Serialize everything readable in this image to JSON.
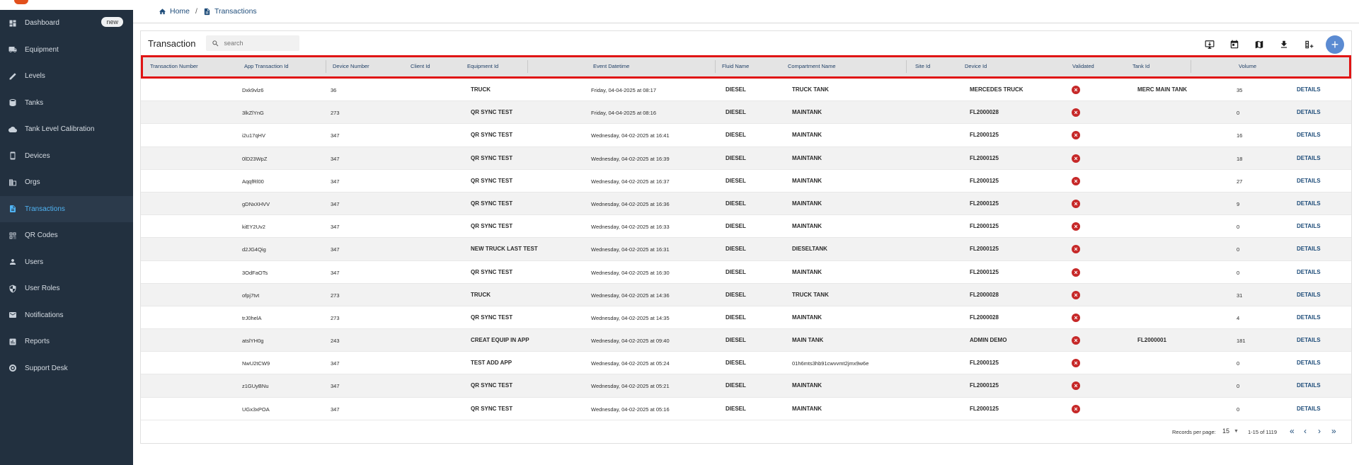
{
  "sidebar": {
    "items": [
      {
        "label": "Dashboard",
        "icon": "dashboard-icon",
        "badge": "new"
      },
      {
        "label": "Equipment",
        "icon": "truck-icon"
      },
      {
        "label": "Levels",
        "icon": "ruler-icon"
      },
      {
        "label": "Tanks",
        "icon": "database-icon"
      },
      {
        "label": "Tank Level Calibration",
        "icon": "cloud-icon"
      },
      {
        "label": "Devices",
        "icon": "device-icon"
      },
      {
        "label": "Orgs",
        "icon": "building-icon"
      },
      {
        "label": "Transactions",
        "icon": "receipt-icon",
        "active": true
      },
      {
        "label": "QR Codes",
        "icon": "qr-icon"
      },
      {
        "label": "Users",
        "icon": "user-icon"
      },
      {
        "label": "User Roles",
        "icon": "shield-icon"
      },
      {
        "label": "Notifications",
        "icon": "bell-icon"
      },
      {
        "label": "Reports",
        "icon": "chart-icon"
      },
      {
        "label": "Support Desk",
        "icon": "support-icon"
      }
    ]
  },
  "breadcrumb": {
    "home": "Home",
    "separator": "/",
    "current": "Transactions"
  },
  "panel": {
    "title": "Transaction",
    "search_placeholder": "search"
  },
  "table": {
    "columns": [
      "Transaction Number",
      "App Transaction Id",
      "Device Number",
      "Client Id",
      "Equipment Id",
      "Event Datetime",
      "Fluid Name",
      "Compartment Name",
      "Site Id",
      "Device Id",
      "Validated",
      "Tank Id",
      "Volume"
    ],
    "rows": [
      {
        "app_id": "Dxk9vlz6",
        "device_number": "36",
        "equipment": "TRUCK",
        "datetime": "Friday, 04-04-2025 at 08:17",
        "fluid": "DIESEL",
        "compartment": "TRUCK TANK",
        "device_id": "MERCEDES TRUCK",
        "tank_id": "MERC MAIN TANK",
        "volume": "35"
      },
      {
        "app_id": "3lkZlYnG",
        "device_number": "273",
        "equipment": "QR SYNC TEST",
        "datetime": "Friday, 04-04-2025 at 08:16",
        "fluid": "DIESEL",
        "compartment": "MAINTANK",
        "device_id": "FL2000028",
        "tank_id": "",
        "volume": "0"
      },
      {
        "app_id": "i2u17qHV",
        "device_number": "347",
        "equipment": "QR SYNC TEST",
        "datetime": "Wednesday, 04-02-2025 at 16:41",
        "fluid": "DIESEL",
        "compartment": "MAINTANK",
        "device_id": "FL2000125",
        "tank_id": "",
        "volume": "16"
      },
      {
        "app_id": "0lD23WpZ",
        "device_number": "347",
        "equipment": "QR SYNC TEST",
        "datetime": "Wednesday, 04-02-2025 at 16:39",
        "fluid": "DIESEL",
        "compartment": "MAINTANK",
        "device_id": "FL2000125",
        "tank_id": "",
        "volume": "18"
      },
      {
        "app_id": "AqqfRl00",
        "device_number": "347",
        "equipment": "QR SYNC TEST",
        "datetime": "Wednesday, 04-02-2025 at 16:37",
        "fluid": "DIESEL",
        "compartment": "MAINTANK",
        "device_id": "FL2000125",
        "tank_id": "",
        "volume": "27"
      },
      {
        "app_id": "gDNxXHVV",
        "device_number": "347",
        "equipment": "QR SYNC TEST",
        "datetime": "Wednesday, 04-02-2025 at 16:36",
        "fluid": "DIESEL",
        "compartment": "MAINTANK",
        "device_id": "FL2000125",
        "tank_id": "",
        "volume": "9"
      },
      {
        "app_id": "kiEY2Uv2",
        "device_number": "347",
        "equipment": "QR SYNC TEST",
        "datetime": "Wednesday, 04-02-2025 at 16:33",
        "fluid": "DIESEL",
        "compartment": "MAINTANK",
        "device_id": "FL2000125",
        "tank_id": "",
        "volume": "0"
      },
      {
        "app_id": "d2JG4Qig",
        "device_number": "347",
        "equipment": "NEW TRUCK LAST TEST",
        "datetime": "Wednesday, 04-02-2025 at 16:31",
        "fluid": "DIESEL",
        "compartment": "DIESELTANK",
        "device_id": "FL2000125",
        "tank_id": "",
        "volume": "0"
      },
      {
        "app_id": "3OdFaOTs",
        "device_number": "347",
        "equipment": "QR SYNC TEST",
        "datetime": "Wednesday, 04-02-2025 at 16:30",
        "fluid": "DIESEL",
        "compartment": "MAINTANK",
        "device_id": "FL2000125",
        "tank_id": "",
        "volume": "0"
      },
      {
        "app_id": "ofpj7tvt",
        "device_number": "273",
        "equipment": "TRUCK",
        "datetime": "Wednesday, 04-02-2025 at 14:36",
        "fluid": "DIESEL",
        "compartment": "TRUCK TANK",
        "device_id": "FL2000028",
        "tank_id": "",
        "volume": "31"
      },
      {
        "app_id": "trJ0helA",
        "device_number": "273",
        "equipment": "QR SYNC TEST",
        "datetime": "Wednesday, 04-02-2025 at 14:35",
        "fluid": "DIESEL",
        "compartment": "MAINTANK",
        "device_id": "FL2000028",
        "tank_id": "",
        "volume": "4"
      },
      {
        "app_id": "atslYH0g",
        "device_number": "243",
        "equipment": "CREAT EQUIP IN APP",
        "datetime": "Wednesday, 04-02-2025 at 09:40",
        "fluid": "DIESEL",
        "compartment": "MAIN TANK",
        "device_id": "ADMIN DEMO",
        "tank_id": "FL2000001",
        "volume": "181"
      },
      {
        "app_id": "NwU2tCW9",
        "device_number": "347",
        "equipment": "TEST ADD APP",
        "datetime": "Wednesday, 04-02-2025 at 05:24",
        "fluid": "DIESEL",
        "compartment": "01h6mts3hb91cwvvmt2jmx9w6e",
        "device_id": "FL2000125",
        "tank_id": "",
        "volume": "0"
      },
      {
        "app_id": "z1GUyBNu",
        "device_number": "347",
        "equipment": "QR SYNC TEST",
        "datetime": "Wednesday, 04-02-2025 at 05:21",
        "fluid": "DIESEL",
        "compartment": "MAINTANK",
        "device_id": "FL2000125",
        "tank_id": "",
        "volume": "0"
      },
      {
        "app_id": "UGx3xPOA",
        "device_number": "347",
        "equipment": "QR SYNC TEST",
        "datetime": "Wednesday, 04-02-2025 at 05:16",
        "fluid": "DIESEL",
        "compartment": "MAINTANK",
        "device_id": "FL2000125",
        "tank_id": "",
        "volume": "0"
      }
    ],
    "validated_icon": "x-circle-icon",
    "details_label": "DETAILS"
  },
  "pagination": {
    "records_label": "Records per page:",
    "per_page": "15",
    "range": "1-15 of 1119"
  },
  "colors": {
    "sidebar": "#22303f",
    "active": "#4fb3f3",
    "accent": "#1f4d7a",
    "error": "#c62828",
    "highlight": "#e01414"
  }
}
